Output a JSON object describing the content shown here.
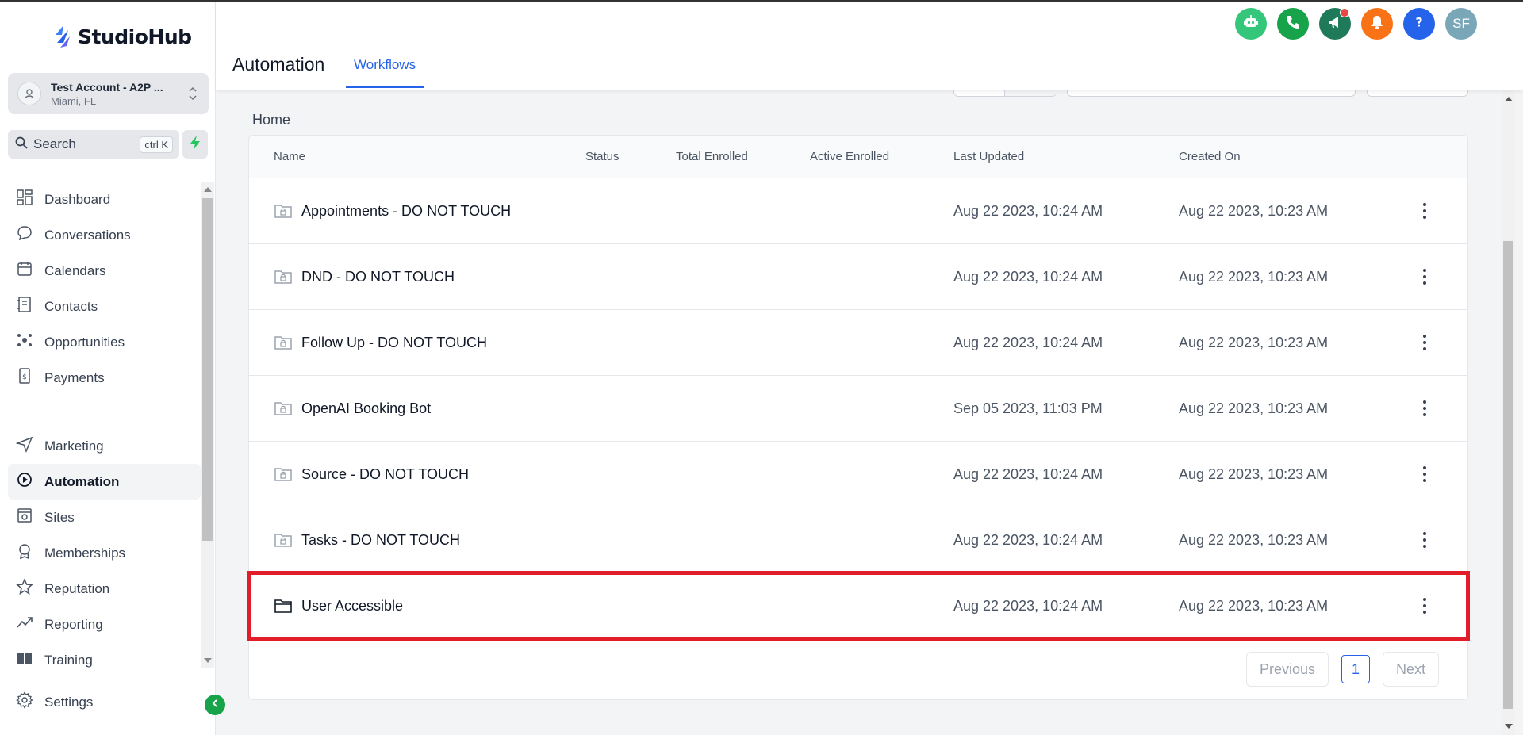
{
  "brand": {
    "name": "StudioHub",
    "accent": "#2563eb"
  },
  "account": {
    "name": "Test Account - A2P ...",
    "location": "Miami, FL"
  },
  "search": {
    "label": "Search",
    "shortcut": "ctrl K"
  },
  "sidebar": {
    "items": [
      {
        "label": "Dashboard",
        "icon": "dashboard-icon"
      },
      {
        "label": "Conversations",
        "icon": "chat-icon"
      },
      {
        "label": "Calendars",
        "icon": "calendar-icon"
      },
      {
        "label": "Contacts",
        "icon": "contacts-icon"
      },
      {
        "label": "Opportunities",
        "icon": "opportunities-icon"
      },
      {
        "label": "Payments",
        "icon": "payments-icon"
      }
    ],
    "items2": [
      {
        "label": "Marketing",
        "icon": "send-icon"
      },
      {
        "label": "Automation",
        "icon": "automation-icon",
        "active": true
      },
      {
        "label": "Sites",
        "icon": "sites-icon"
      },
      {
        "label": "Memberships",
        "icon": "membership-icon"
      },
      {
        "label": "Reputation",
        "icon": "star-icon"
      },
      {
        "label": "Reporting",
        "icon": "trend-icon"
      },
      {
        "label": "Training",
        "icon": "book-icon"
      }
    ],
    "settings": "Settings"
  },
  "header": {
    "title": "Automation",
    "tab": "Workflows",
    "icons": [
      {
        "name": "robot-icon",
        "color": "#34c77b"
      },
      {
        "name": "phone-icon",
        "color": "#16a34a"
      },
      {
        "name": "megaphone-icon",
        "color": "#1f7a5a"
      },
      {
        "name": "bell-icon",
        "color": "#f97316"
      },
      {
        "name": "help-icon",
        "color": "#2563eb"
      }
    ],
    "avatar": {
      "initials": "SF",
      "color": "#7aa7b8"
    }
  },
  "breadcrumb": "Home",
  "table": {
    "columns": [
      "Name",
      "Status",
      "Total Enrolled",
      "Active Enrolled",
      "Last Updated",
      "Created On"
    ],
    "rows": [
      {
        "name": "Appointments - DO NOT TOUCH",
        "updated": "Aug 22 2023, 10:24 AM",
        "created": "Aug 22 2023, 10:23 AM",
        "locked": true
      },
      {
        "name": "DND - DO NOT TOUCH",
        "updated": "Aug 22 2023, 10:24 AM",
        "created": "Aug 22 2023, 10:23 AM",
        "locked": true
      },
      {
        "name": "Follow Up - DO NOT TOUCH",
        "updated": "Aug 22 2023, 10:24 AM",
        "created": "Aug 22 2023, 10:23 AM",
        "locked": true
      },
      {
        "name": "OpenAI Booking Bot",
        "updated": "Sep 05 2023, 11:03 PM",
        "created": "Aug 22 2023, 10:23 AM",
        "locked": true
      },
      {
        "name": "Source - DO NOT TOUCH",
        "updated": "Aug 22 2023, 10:24 AM",
        "created": "Aug 22 2023, 10:23 AM",
        "locked": true
      },
      {
        "name": "Tasks - DO NOT TOUCH",
        "updated": "Aug 22 2023, 10:24 AM",
        "created": "Aug 22 2023, 10:23 AM",
        "locked": true
      },
      {
        "name": "User Accessible",
        "updated": "Aug 22 2023, 10:24 AM",
        "created": "Aug 22 2023, 10:23 AM",
        "locked": false,
        "highlighted": true
      }
    ]
  },
  "pagination": {
    "previous": "Previous",
    "page": "1",
    "next": "Next"
  },
  "colors": {
    "highlight": "#e11d2a"
  }
}
